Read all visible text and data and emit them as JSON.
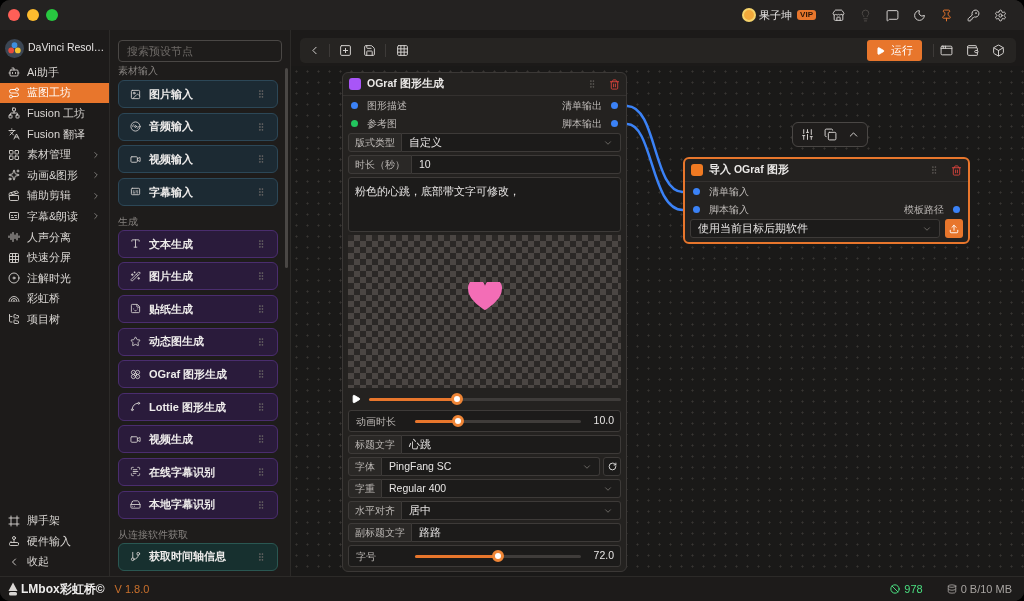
{
  "titlebar": {
    "user": {
      "name": "果子坤",
      "badge": "VIP"
    },
    "pinned": true,
    "hints_enabled": false
  },
  "sidebar": {
    "app_name": "DaVinci Resol…",
    "items": [
      {
        "label": "Ai助手",
        "selected": false,
        "submenu": false
      },
      {
        "label": "蓝图工坊",
        "selected": true,
        "submenu": false
      },
      {
        "label": "Fusion 工坊",
        "selected": false,
        "submenu": false
      },
      {
        "label": "Fusion 翻译",
        "selected": false,
        "submenu": false
      },
      {
        "label": "素材管理",
        "selected": false,
        "submenu": true
      },
      {
        "label": "动画&图形",
        "selected": false,
        "submenu": true
      },
      {
        "label": "辅助剪辑",
        "selected": false,
        "submenu": true
      },
      {
        "label": "字幕&朗读",
        "selected": false,
        "submenu": true
      },
      {
        "label": "人声分离",
        "selected": false,
        "submenu": false
      },
      {
        "label": "快速分屏",
        "selected": false,
        "submenu": false
      },
      {
        "label": "注解时光",
        "selected": false,
        "submenu": false
      },
      {
        "label": "彩虹桥",
        "selected": false,
        "submenu": false
      },
      {
        "label": "项目树",
        "selected": false,
        "submenu": false
      }
    ],
    "footer_items": [
      {
        "label": "脚手架",
        "selected": false
      },
      {
        "label": "硬件输入",
        "selected": false
      },
      {
        "label": "收起",
        "selected": false
      }
    ]
  },
  "presets": {
    "search": {
      "placeholder": "搜索预设节点"
    },
    "sections": [
      {
        "title": "素材输入",
        "kind": "input",
        "items": [
          "图片输入",
          "音频输入",
          "视频输入",
          "字幕输入"
        ]
      },
      {
        "title": "生成",
        "kind": "generate",
        "items": [
          "文本生成",
          "图片生成",
          "贴纸生成",
          "动态图生成",
          "OGraf 图形生成",
          "Lottie 图形生成",
          "视频生成",
          "在线字幕识别",
          "本地字幕识别"
        ]
      },
      {
        "title": "从连接软件获取",
        "kind": "fetch",
        "items": [
          "获取时间轴信息"
        ]
      }
    ]
  },
  "toolbar": {
    "run_button": "运行"
  },
  "canvas": {
    "nodes": [
      {
        "title": "OGraf 图形生成",
        "color": "#a855f7",
        "selected": false,
        "port_rows": [
          {
            "input": {
              "label": "图形描述",
              "color": "#3b82f6"
            },
            "output": {
              "label": "清单输出",
              "color": "#3b82f6"
            }
          },
          {
            "input": {
              "label": "参考图",
              "color": "#22c55e"
            },
            "output": {
              "label": "脚本输出",
              "color": "#3b82f6"
            }
          }
        ],
        "fields": [
          {
            "kind": "select",
            "label": "版式类型",
            "value": "自定义"
          },
          {
            "kind": "input",
            "label": "时长（秒）",
            "value": "10"
          },
          {
            "kind": "textarea",
            "value": "粉色的心跳，底部带文字可修改，"
          },
          {
            "kind": "preview"
          },
          {
            "kind": "playback",
            "level": 0.35
          },
          {
            "kind": "slider",
            "label": "动画时长",
            "level": 0.26,
            "reading": "10.0"
          },
          {
            "kind": "input",
            "label": "标题文字",
            "value": "心跳"
          },
          {
            "kind": "select",
            "label": "字体",
            "value": "PingFang SC",
            "button": {
              "kind": "refresh"
            }
          },
          {
            "kind": "select",
            "label": "字重",
            "value": "Regular 400"
          },
          {
            "kind": "select",
            "label": "水平对齐",
            "value": "居中"
          },
          {
            "kind": "input",
            "label": "副标题文字",
            "value": "路路"
          },
          {
            "kind": "slider",
            "label": "字号",
            "level": 0.5,
            "reading": "72.0"
          }
        ]
      },
      {
        "title": "导入 OGraf 图形",
        "color": "#f07a22",
        "selected": true,
        "port_rows": [
          {
            "input": {
              "label": "清单输入",
              "color": "#3b82f6"
            }
          },
          {
            "input": {
              "label": "脚本输入",
              "color": "#3b82f6"
            },
            "output": {
              "label": "模板路径",
              "color": "#3b82f6"
            }
          }
        ],
        "fields": [
          {
            "kind": "select",
            "value": "使用当前目标后期软件",
            "button": {
              "kind": "upload"
            }
          }
        ]
      }
    ]
  },
  "status_bar": {
    "brand": "LMbox彩虹桥©",
    "version": "V 1.8.0",
    "count": "978",
    "storage": "0 B/10 MB"
  }
}
